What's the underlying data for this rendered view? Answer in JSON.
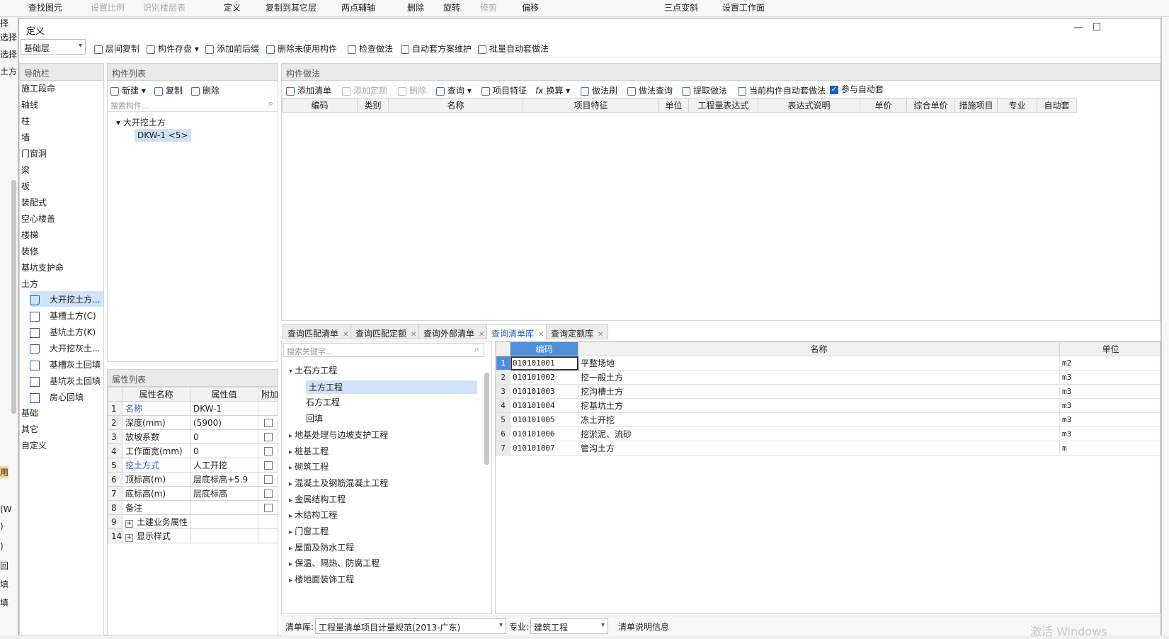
{
  "bg_toolbar": {
    "items": [
      "查找图元",
      "设置比例",
      "识别楼层表",
      "定义",
      "复制到其它层",
      "两点辅轴",
      "删除",
      "旋转",
      "修剪",
      "偏移",
      "三点变斜",
      "设置工作面"
    ]
  },
  "bg_left": {
    "items": [
      "择",
      "选择",
      "选择",
      "土方",
      "用",
      "(W",
      ")",
      ")",
      "回",
      "填",
      "填"
    ]
  },
  "dialog": {
    "title": "定义",
    "min": "—",
    "max": "☐"
  },
  "toolbar1": {
    "floor_select": "基础层",
    "buttons": [
      "层间复制",
      "构件存盘",
      "添加前后缀",
      "删除未使用构件",
      "检查做法",
      "自动套方案维护",
      "批量自动套做法"
    ]
  },
  "nav": {
    "title": "导航栏",
    "items": [
      "施工段命",
      "轴线",
      "柱",
      "墙",
      "门窗洞",
      "梁",
      "板",
      "装配式",
      "空心楼盖",
      "楼梯",
      "装修",
      "基坑支护命",
      "土方"
    ],
    "sub_items": [
      "大开挖土方...",
      "基槽土方(C)",
      "基坑土方(K)",
      "大开挖灰土...",
      "基槽灰土回填",
      "基坑灰土回填",
      "房心回填"
    ],
    "tail_items": [
      "基础",
      "其它",
      "自定义"
    ]
  },
  "component_list": {
    "title": "构件列表",
    "buttons": [
      "新建",
      "复制",
      "删除"
    ],
    "search_placeholder": "搜索构件...",
    "tree_root": "大开挖土方",
    "tree_child": "DKW-1 <5>"
  },
  "props": {
    "title": "属性列表",
    "headers": [
      "属性名称",
      "属性值",
      "附加"
    ],
    "rows": [
      {
        "no": "1",
        "name": "名称",
        "value": "DKW-1",
        "blue": true,
        "cb": false
      },
      {
        "no": "2",
        "name": "深度(mm)",
        "value": "(5900)",
        "blue": false,
        "cb": true
      },
      {
        "no": "3",
        "name": "放坡系数",
        "value": "0",
        "blue": false,
        "cb": true
      },
      {
        "no": "4",
        "name": "工作面宽(mm)",
        "value": "0",
        "blue": false,
        "cb": true
      },
      {
        "no": "5",
        "name": "挖土方式",
        "value": "人工开挖",
        "blue": true,
        "cb": true
      },
      {
        "no": "6",
        "name": "顶标高(m)",
        "value": "层底标高+5.9",
        "blue": false,
        "cb": true
      },
      {
        "no": "7",
        "name": "底标高(m)",
        "value": "层底标高",
        "blue": false,
        "cb": true
      },
      {
        "no": "8",
        "name": "备注",
        "value": "",
        "blue": false,
        "cb": true
      },
      {
        "no": "9",
        "name": "土建业务属性",
        "value": "",
        "blue": false,
        "cb": false,
        "expand": true
      },
      {
        "no": "14",
        "name": "显示样式",
        "value": "",
        "blue": false,
        "cb": false,
        "expand": true
      }
    ]
  },
  "method": {
    "title": "构件做法",
    "buttons": [
      "添加清单",
      "添加定额",
      "删除",
      "查询",
      "项目特征",
      "换算",
      "做法刷",
      "做法查询",
      "提取做法",
      "当前构件自动套做法"
    ],
    "auto_label": "参与自动套",
    "headers": [
      "编码",
      "类别",
      "名称",
      "项目特征",
      "单位",
      "工程量表达式",
      "表达式说明",
      "单价",
      "综合单价",
      "措施项目",
      "专业",
      "自动套"
    ]
  },
  "tabs": [
    "查询匹配清单",
    "查询匹配定额",
    "查询外部清单",
    "查询清单库",
    "查询定额库"
  ],
  "library": {
    "search_placeholder": "搜索关键字...",
    "tree": [
      {
        "label": "土石方工程",
        "level": 0,
        "open": true
      },
      {
        "label": "土方工程",
        "level": 1,
        "sel": true
      },
      {
        "label": "石方工程",
        "level": 1
      },
      {
        "label": "回填",
        "level": 1
      },
      {
        "label": "地基处理与边坡支护工程",
        "level": 0
      },
      {
        "label": "桩基工程",
        "level": 0
      },
      {
        "label": "砌筑工程",
        "level": 0
      },
      {
        "label": "混凝土及钢筋混凝土工程",
        "level": 0
      },
      {
        "label": "金属结构工程",
        "level": 0
      },
      {
        "label": "木结构工程",
        "level": 0
      },
      {
        "label": "门窗工程",
        "level": 0
      },
      {
        "label": "屋面及防水工程",
        "level": 0
      },
      {
        "label": "保温、隔热、防腐工程",
        "level": 0
      },
      {
        "label": "楼地面装饰工程",
        "level": 0
      }
    ],
    "headers": [
      "编码",
      "名称",
      "单位"
    ],
    "rows": [
      {
        "no": "1",
        "code": "010101001",
        "name": "平整场地",
        "unit": "m2"
      },
      {
        "no": "2",
        "code": "010101002",
        "name": "挖一般土方",
        "unit": "m3"
      },
      {
        "no": "3",
        "code": "010101003",
        "name": "挖沟槽土方",
        "unit": "m3"
      },
      {
        "no": "4",
        "code": "010101004",
        "name": "挖基坑土方",
        "unit": "m3"
      },
      {
        "no": "5",
        "code": "010101005",
        "name": "冻土开挖",
        "unit": "m3"
      },
      {
        "no": "6",
        "code": "010101006",
        "name": "挖淤泥、流砂",
        "unit": "m3"
      },
      {
        "no": "7",
        "code": "010101007",
        "name": "管沟土方",
        "unit": "m"
      }
    ]
  },
  "statusbar": {
    "lib_label": "清单库:",
    "lib_value": "工程量清单项目计量规范(2013-广东)",
    "major_label": "专业:",
    "major_value": "建筑工程",
    "info": "清单说明信息",
    "watermark": "激活 Windows"
  }
}
